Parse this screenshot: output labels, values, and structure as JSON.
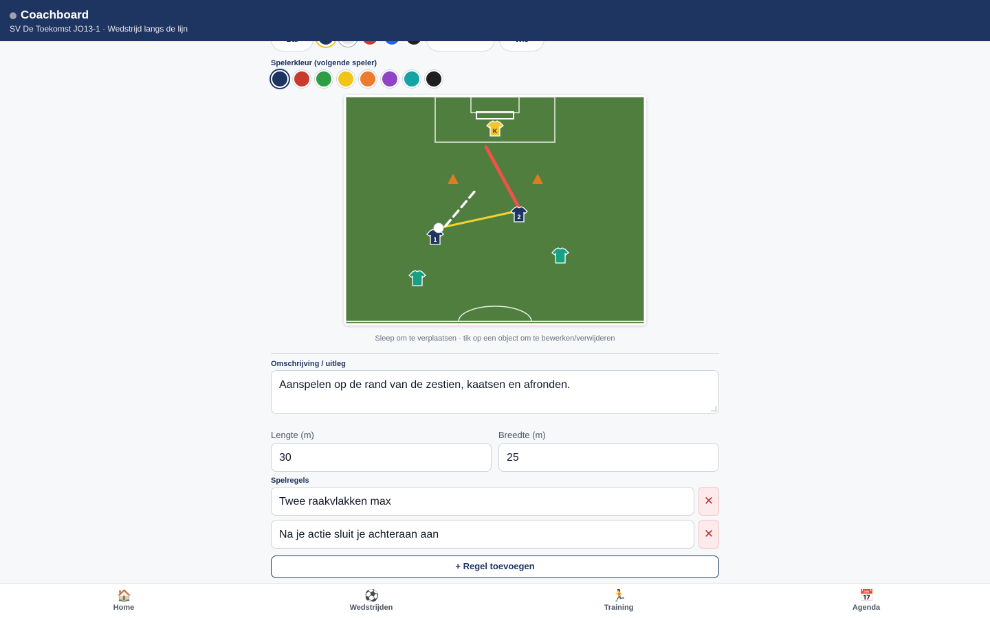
{
  "header": {
    "title": "Coachboard",
    "subtitle": "SV De Toekomst JO13-1 · Wedstrijd langs de lijn"
  },
  "toolbar": {
    "pill_1": "Bal",
    "pill_2": "",
    "pill_3": "Wis"
  },
  "player_color": {
    "label": "Spelerkleur (volgende speler)",
    "colors": [
      "#1e3461",
      "#c93a2e",
      "#2e9d45",
      "#f0c419",
      "#ed7b2d",
      "#8e44c4",
      "#15a3a6",
      "#1f1f1f"
    ],
    "selected_index": 0
  },
  "board": {
    "keeper_label": "K",
    "player1_label": "1",
    "player2_label": "2",
    "hint": "Sleep om te verplaatsen · tik op een object om te bewerken/verwijderen"
  },
  "description": {
    "label": "Omschrijving / uitleg",
    "value": "Aanspelen op de rand van de zestien, kaatsen en afronden."
  },
  "dimensions": {
    "length_label": "Lengte (m)",
    "length_value": "30",
    "width_label": "Breedte (m)",
    "width_value": "25"
  },
  "rules": {
    "label": "Spelregels",
    "items": [
      "Twee raakvlakken max",
      "Na je actie sluit je achteraan aan"
    ],
    "add_label": "+ Regel toevoegen",
    "remove_glyph": "✕"
  },
  "nav": {
    "items": [
      {
        "label": "Home",
        "icon": "🏠"
      },
      {
        "label": "Wedstrijden",
        "icon": "⚽"
      },
      {
        "label": "Training",
        "icon": "🏃"
      },
      {
        "label": "Agenda",
        "icon": "📅"
      }
    ]
  }
}
